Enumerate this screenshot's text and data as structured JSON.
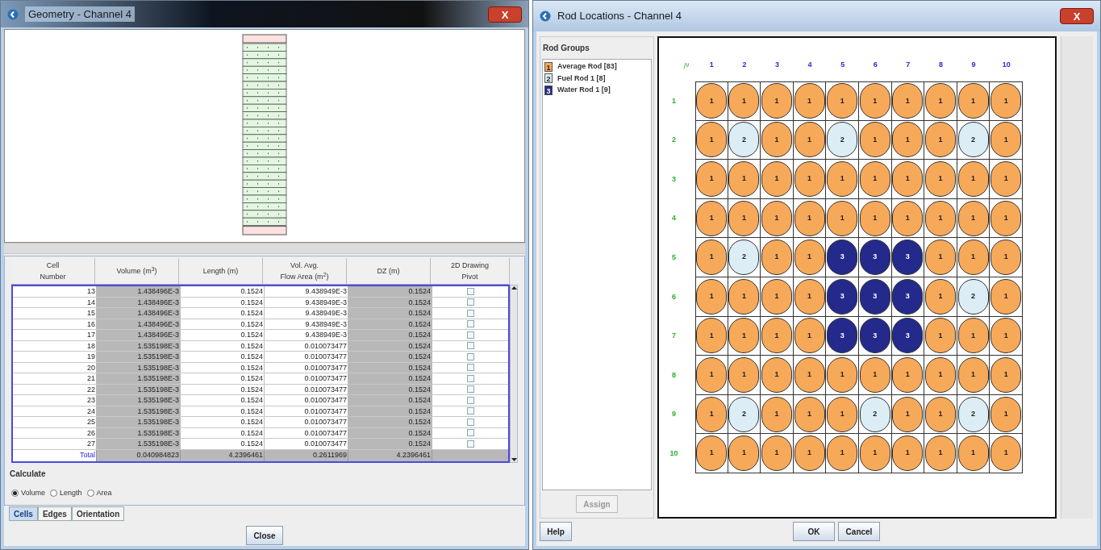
{
  "geometry_window": {
    "title": "Geometry - Channel 4",
    "close": "X",
    "table": {
      "columns": [
        "Cell\nNumber",
        "Volume (m$^{3}$)",
        "Length (m)",
        "Vol. Avg.\nFlow Area (m$^{2}$)",
        "DZ (m)",
        "2D Drawing\nPivot"
      ],
      "rows": [
        {
          "cells": [
            "13",
            "1.438496E-3",
            "0.1524",
            "9.438949E-3",
            "0.1524"
          ],
          "checked": false
        },
        {
          "cells": [
            "14",
            "1.438496E-3",
            "0.1524",
            "9.438949E-3",
            "0.1524"
          ],
          "checked": false
        },
        {
          "cells": [
            "15",
            "1.438496E-3",
            "0.1524",
            "9.438949E-3",
            "0.1524"
          ],
          "checked": false
        },
        {
          "cells": [
            "16",
            "1.438496E-3",
            "0.1524",
            "9.438949E-3",
            "0.1524"
          ],
          "checked": false
        },
        {
          "cells": [
            "17",
            "1.438496E-3",
            "0.1524",
            "9.438949E-3",
            "0.1524"
          ],
          "checked": false
        },
        {
          "cells": [
            "18",
            "1.535198E-3",
            "0.1524",
            "0.010073477",
            "0.1524"
          ],
          "checked": false
        },
        {
          "cells": [
            "19",
            "1.535198E-3",
            "0.1524",
            "0.010073477",
            "0.1524"
          ],
          "checked": false
        },
        {
          "cells": [
            "20",
            "1.535198E-3",
            "0.1524",
            "0.010073477",
            "0.1524"
          ],
          "checked": false
        },
        {
          "cells": [
            "21",
            "1.535198E-3",
            "0.1524",
            "0.010073477",
            "0.1524"
          ],
          "checked": false
        },
        {
          "cells": [
            "22",
            "1.535198E-3",
            "0.1524",
            "0.010073477",
            "0.1524"
          ],
          "checked": false
        },
        {
          "cells": [
            "23",
            "1.535198E-3",
            "0.1524",
            "0.010073477",
            "0.1524"
          ],
          "checked": false
        },
        {
          "cells": [
            "24",
            "1.535198E-3",
            "0.1524",
            "0.010073477",
            "0.1524"
          ],
          "checked": false
        },
        {
          "cells": [
            "25",
            "1.535198E-3",
            "0.1524",
            "0.010073477",
            "0.1524"
          ],
          "checked": false
        },
        {
          "cells": [
            "26",
            "1.535198E-3",
            "0.1524",
            "0.010073477",
            "0.1524"
          ],
          "checked": false
        },
        {
          "cells": [
            "27",
            "1.535198E-3",
            "0.1524",
            "0.010073477",
            "0.1524"
          ],
          "checked": false
        }
      ],
      "total": [
        "Total",
        "0.040984823",
        "4.2396461",
        "0.2611969",
        "4.2396461"
      ]
    },
    "calculate": {
      "title": "Calculate",
      "options": [
        {
          "label": "Volume",
          "selected": true
        },
        {
          "label": "Length",
          "selected": false
        },
        {
          "label": "Area",
          "selected": false
        }
      ]
    },
    "tabs": [
      {
        "label": "Cells",
        "selected": true
      },
      {
        "label": "Edges",
        "selected": false
      },
      {
        "label": "Orientation",
        "selected": false
      }
    ],
    "buttons": [
      "Close"
    ]
  },
  "rod_window": {
    "title": "Rod Locations - Channel 4",
    "close": "X",
    "groups_title": "Rod Groups",
    "groups": [
      {
        "number": "1",
        "label": "Average Rod [83]",
        "color": "#f7a95a"
      },
      {
        "number": "2",
        "label": "Fuel Rod 1 [8]",
        "color": "#dcedf5"
      },
      {
        "number": "3",
        "label": "Water Rod 1 [9]",
        "color": "#232a8c"
      }
    ],
    "assign": "Assign",
    "axis_label": "j\\i",
    "columns": [
      "1",
      "2",
      "3",
      "4",
      "5",
      "6",
      "7",
      "8",
      "9",
      "10"
    ],
    "rows": [
      {
        "label": "1",
        "cells": [
          "1",
          "1",
          "1",
          "1",
          "1",
          "1",
          "1",
          "1",
          "1",
          "1"
        ]
      },
      {
        "label": "2",
        "cells": [
          "1",
          "2",
          "1",
          "1",
          "2",
          "1",
          "1",
          "1",
          "2",
          "1"
        ]
      },
      {
        "label": "3",
        "cells": [
          "1",
          "1",
          "1",
          "1",
          "1",
          "1",
          "1",
          "1",
          "1",
          "1"
        ]
      },
      {
        "label": "4",
        "cells": [
          "1",
          "1",
          "1",
          "1",
          "1",
          "1",
          "1",
          "1",
          "1",
          "1"
        ]
      },
      {
        "label": "5",
        "cells": [
          "1",
          "2",
          "1",
          "1",
          "3",
          "3",
          "3",
          "1",
          "1",
          "1"
        ]
      },
      {
        "label": "6",
        "cells": [
          "1",
          "1",
          "1",
          "1",
          "3",
          "3",
          "3",
          "1",
          "2",
          "1"
        ]
      },
      {
        "label": "7",
        "cells": [
          "1",
          "1",
          "1",
          "1",
          "3",
          "3",
          "3",
          "1",
          "1",
          "1"
        ]
      },
      {
        "label": "8",
        "cells": [
          "1",
          "1",
          "1",
          "1",
          "1",
          "1",
          "1",
          "1",
          "1",
          "1"
        ]
      },
      {
        "label": "9",
        "cells": [
          "1",
          "2",
          "1",
          "1",
          "1",
          "2",
          "1",
          "1",
          "2",
          "1"
        ]
      },
      {
        "label": "10",
        "cells": [
          "1",
          "1",
          "1",
          "1",
          "1",
          "1",
          "1",
          "1",
          "1",
          "1"
        ]
      }
    ],
    "help": "Help",
    "buttons": [
      "OK",
      "Cancel"
    ]
  }
}
